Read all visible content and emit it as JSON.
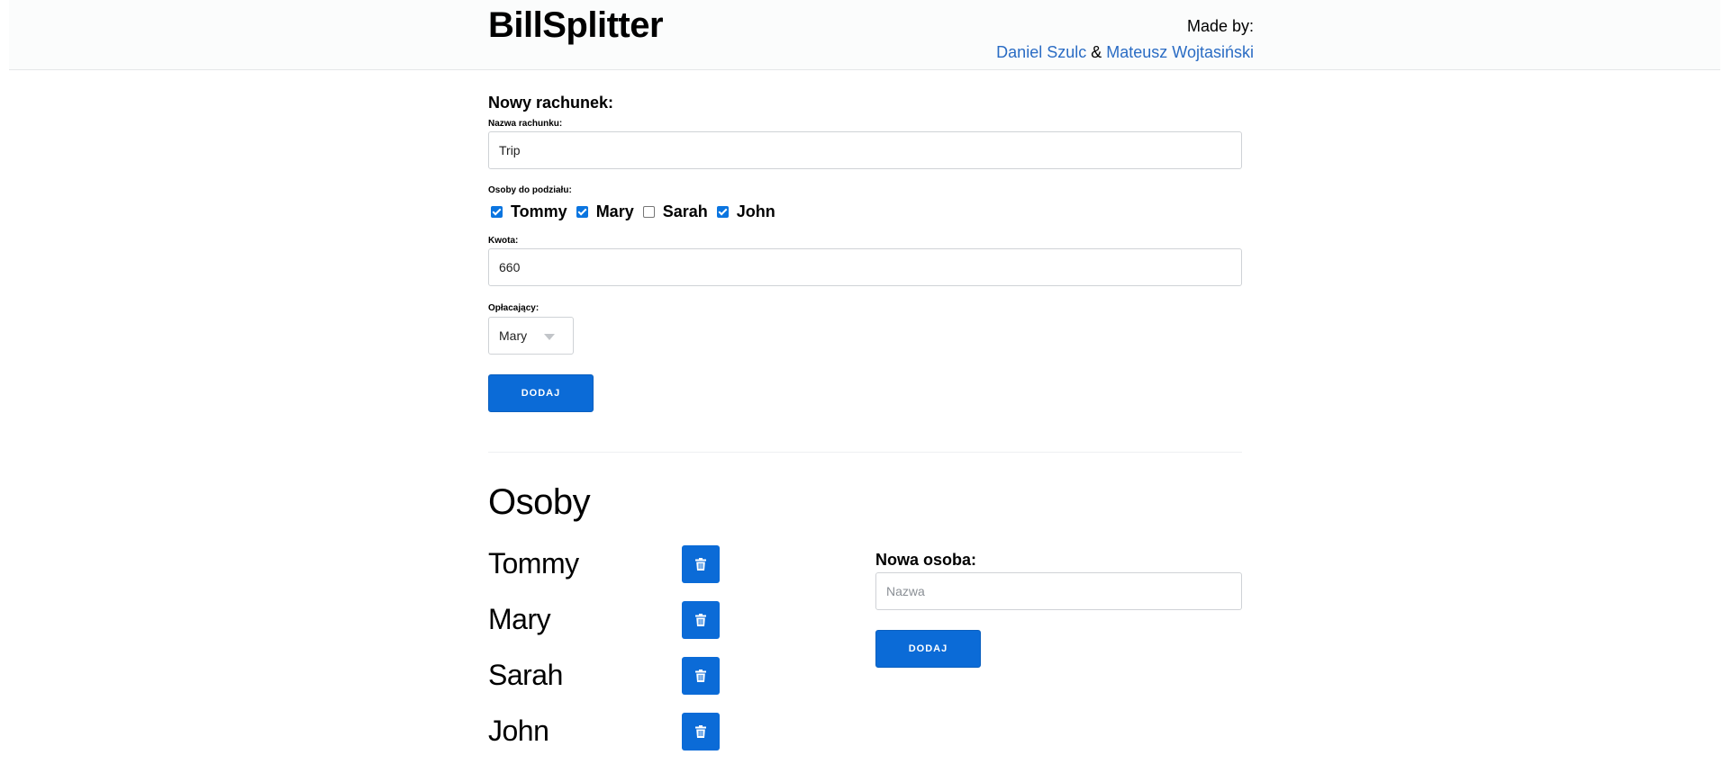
{
  "header": {
    "brand": "BillSplitter",
    "made_by_label": "Made by:",
    "author1": "Daniel Szulc",
    "separator": "&",
    "author2": "Mateusz Wojtasiński"
  },
  "new_bill": {
    "title": "Nowy rachunek:",
    "name_label": "Nazwa rachunku:",
    "name_value": "Trip",
    "people_label": "Osoby do podziału:",
    "people": [
      {
        "name": "Tommy",
        "checked": true
      },
      {
        "name": "Mary",
        "checked": true
      },
      {
        "name": "Sarah",
        "checked": false
      },
      {
        "name": "John",
        "checked": true
      }
    ],
    "amount_label": "Kwota:",
    "amount_value": "660",
    "payer_label": "Opłacający:",
    "payer_value": "Mary",
    "submit_label": "DODAJ"
  },
  "people_section": {
    "title": "Osoby",
    "people": [
      "Tommy",
      "Mary",
      "Sarah",
      "John"
    ],
    "delete_icon": "trash-icon",
    "new_person_label": "Nowa osoba:",
    "new_person_placeholder": "Nazwa",
    "add_label": "DODAJ"
  },
  "colors": {
    "accent": "#0b6bd7",
    "link": "#2a6cc4",
    "header_bg": "#fbfcfc"
  }
}
